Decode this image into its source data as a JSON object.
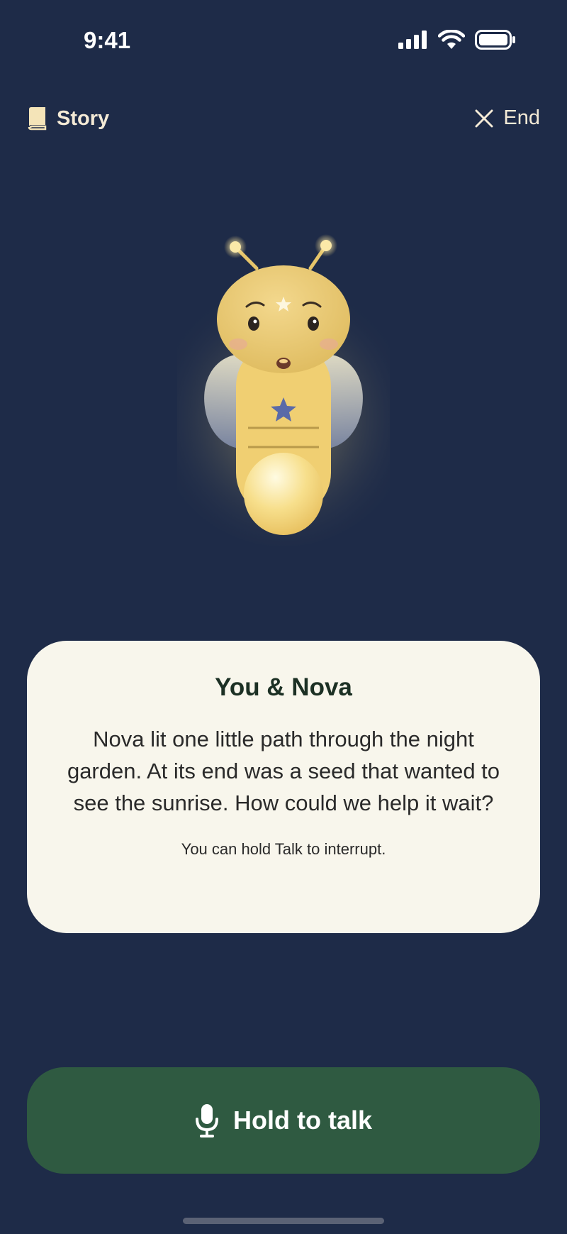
{
  "status_bar": {
    "time": "9:41",
    "icons": [
      "cellular-signal-icon",
      "wifi-icon",
      "battery-icon"
    ]
  },
  "nav": {
    "left": {
      "icon": "book-icon",
      "label": "Story"
    },
    "right": {
      "icon": "close-icon",
      "label": "End"
    }
  },
  "character": {
    "icon": "firefly-nova-illustration",
    "body_star_color": "#5a6aa8"
  },
  "card": {
    "title": "You & Nova",
    "body": "Nova lit one little path through the night garden. At its end was a seed that wanted to see the sunrise. How could we help it wait?",
    "hint": "You can hold Talk to interrupt."
  },
  "talk_button": {
    "icon": "microphone-icon",
    "label": "Hold to talk"
  },
  "colors": {
    "background": "#1e2b48",
    "card": "#f8f6ec",
    "button": "#2f5a41",
    "nav_text": "#f4ead6",
    "glow": "#f5d77e"
  }
}
